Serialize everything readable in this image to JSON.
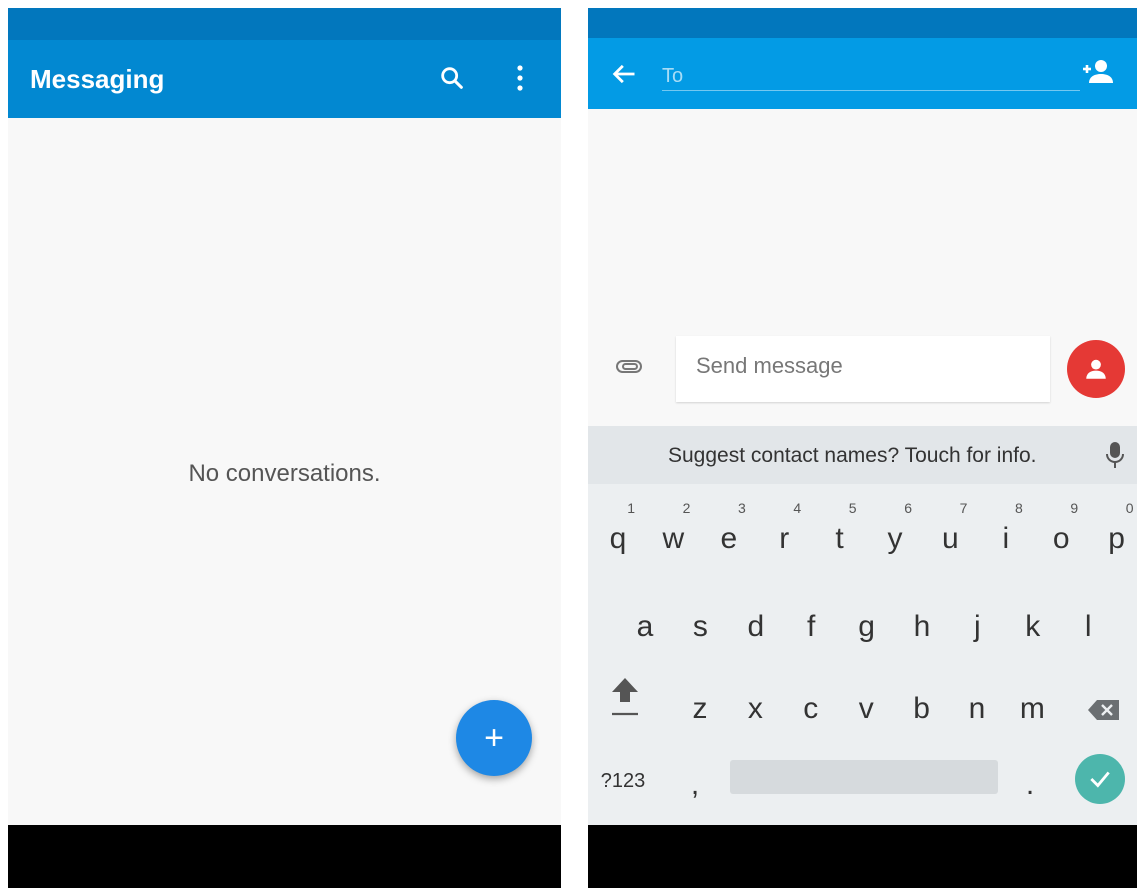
{
  "left_screen": {
    "app_title": "Messaging",
    "empty_state": "No conversations.",
    "fab_label": "+"
  },
  "right_screen": {
    "to_placeholder": "To",
    "message_placeholder": "Send message",
    "suggest_text": "Suggest contact names? Touch for info.",
    "keyboard": {
      "row1": [
        {
          "k": "q",
          "h": "1"
        },
        {
          "k": "w",
          "h": "2"
        },
        {
          "k": "e",
          "h": "3"
        },
        {
          "k": "r",
          "h": "4"
        },
        {
          "k": "t",
          "h": "5"
        },
        {
          "k": "y",
          "h": "6"
        },
        {
          "k": "u",
          "h": "7"
        },
        {
          "k": "i",
          "h": "8"
        },
        {
          "k": "o",
          "h": "9"
        },
        {
          "k": "p",
          "h": "0"
        }
      ],
      "row2": [
        "a",
        "s",
        "d",
        "f",
        "g",
        "h",
        "j",
        "k",
        "l"
      ],
      "row3": [
        "z",
        "x",
        "c",
        "v",
        "b",
        "n",
        "m"
      ],
      "symbols_key": "?123",
      "comma_key": ",",
      "period_key": "."
    }
  },
  "colors": {
    "primary": "#0288d1",
    "status": "#0277bd",
    "fab": "#1e88e5",
    "contact_fab": "#e53935",
    "enter": "#4db6ac"
  }
}
